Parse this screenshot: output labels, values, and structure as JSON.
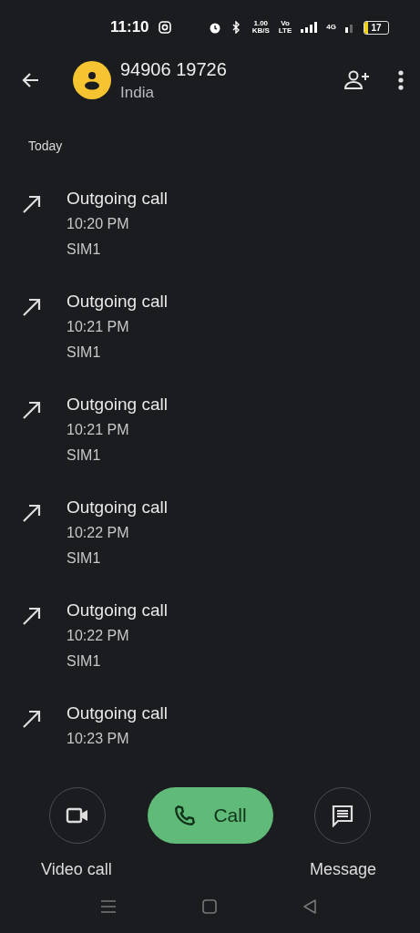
{
  "status_bar": {
    "time": "11:10",
    "speed": "1.00",
    "speed_unit": "KB/S",
    "volte_top": "Vo",
    "volte_bottom": "LTE",
    "network": "4G",
    "battery": {
      "label": "17",
      "level": 0.17
    }
  },
  "header": {
    "number": "94906 19726",
    "location": "India"
  },
  "section": "Today",
  "calls": [
    {
      "title": "Outgoing call",
      "time": "10:20 PM",
      "sim": "SIM1"
    },
    {
      "title": "Outgoing call",
      "time": "10:21 PM",
      "sim": "SIM1"
    },
    {
      "title": "Outgoing call",
      "time": "10:21 PM",
      "sim": "SIM1"
    },
    {
      "title": "Outgoing call",
      "time": "10:22 PM",
      "sim": "SIM1"
    },
    {
      "title": "Outgoing call",
      "time": "10:22 PM",
      "sim": "SIM1"
    },
    {
      "title": "Outgoing call",
      "time": "10:23 PM"
    }
  ],
  "actions": {
    "video": "Video call",
    "call": "Call",
    "message": "Message"
  }
}
